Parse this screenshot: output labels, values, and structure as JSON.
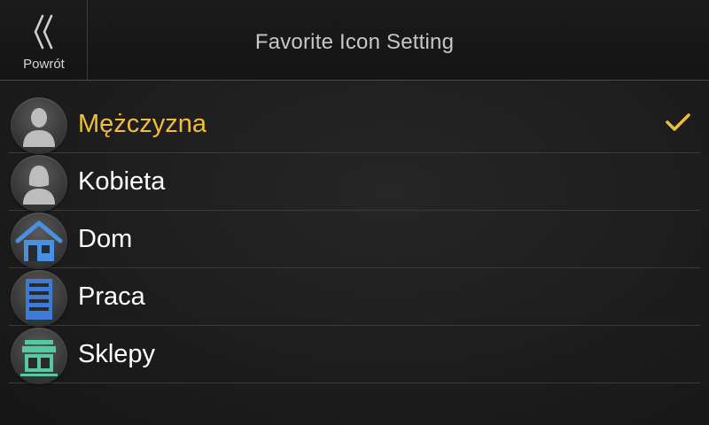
{
  "header": {
    "back_label": "Powrót",
    "title": "Favorite Icon Setting"
  },
  "list": {
    "items": [
      {
        "label": "Mężczyzna",
        "icon": "man-icon",
        "selected": true
      },
      {
        "label": "Kobieta",
        "icon": "woman-icon",
        "selected": false
      },
      {
        "label": "Dom",
        "icon": "home-icon",
        "selected": false
      },
      {
        "label": "Praca",
        "icon": "work-icon",
        "selected": false
      },
      {
        "label": "Sklepy",
        "icon": "shop-icon",
        "selected": false
      }
    ]
  },
  "colors": {
    "selected_text": "#f0bd3c",
    "checkmark": "#f0bd3c",
    "home_icon": "#4a90e2",
    "work_icon": "#3d7bd6",
    "shop_icon": "#55c9a0"
  }
}
